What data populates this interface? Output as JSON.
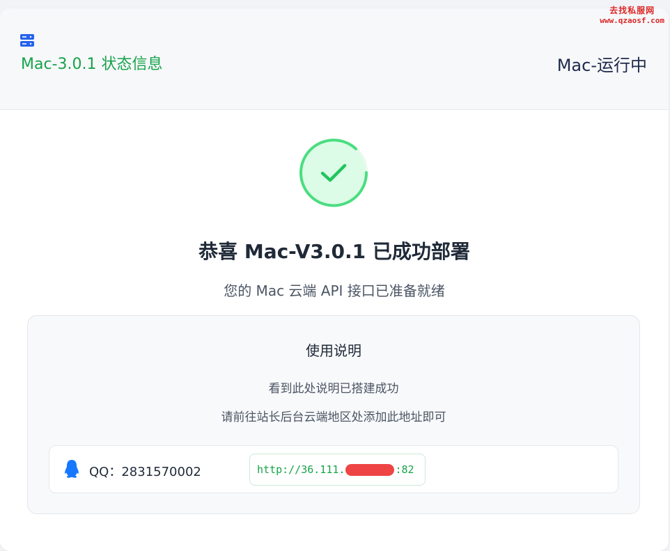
{
  "header": {
    "title": "Mac-3.0.1 状态信息",
    "status": "Mac-运行中",
    "icon": "server-icon"
  },
  "success": {
    "icon": "check-icon",
    "title": "恭喜 Mac-V3.0.1 已成功部署",
    "subtitle": "您的 Mac 云端 API 接口已准备就绪"
  },
  "usage": {
    "title": "使用说明",
    "line1": "看到此处说明已搭建成功",
    "line2": "请前往站长后台云端地区处添加此地址即可"
  },
  "contact": {
    "icon": "qq-icon",
    "qq_label": "QQ：2831570002",
    "url_prefix": "http://36.111.",
    "url_suffix": ":82"
  },
  "watermark": {
    "name": "去找私服网",
    "url": "www.qzaosf.com"
  },
  "colors": {
    "accent_green": "#16a34a",
    "ring_green": "#4ade80",
    "brand_blue": "#2563eb",
    "redaction": "#ef4444"
  }
}
